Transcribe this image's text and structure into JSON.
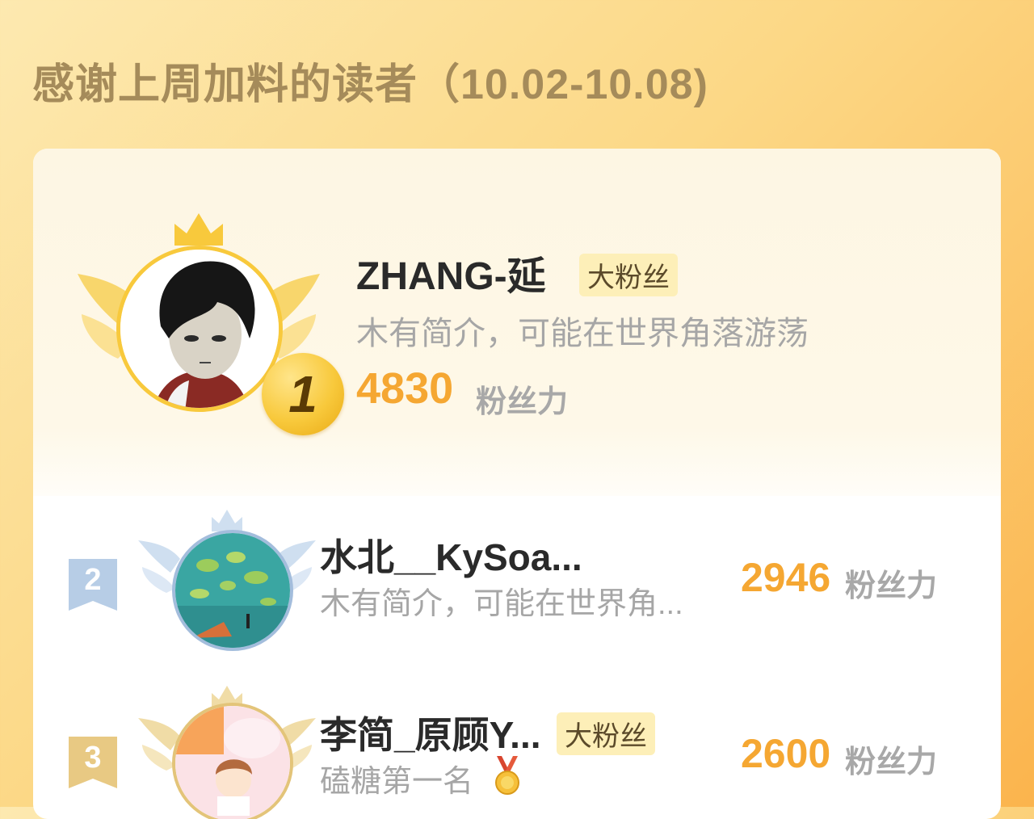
{
  "title": "感谢上周加料的读者（10.02-10.08)",
  "unit_label": "粉丝力",
  "fan_tag": "大粉丝",
  "top_reader": {
    "rank": "1",
    "name": "ZHANG-延",
    "bio": "木有简介，可能在世界角落游荡",
    "value": "4830"
  },
  "readers": [
    {
      "rank": "2",
      "name": "水北__KySoa...",
      "bio": "木有简介，可能在世界角...",
      "value": "2946"
    },
    {
      "rank": "3",
      "name": "李简_原顾Y...",
      "bio": "磕糖第一名",
      "value": "2600"
    }
  ],
  "colors": {
    "gold": "#f8c93c",
    "value": "#f5a732",
    "silver": "#b7cde6",
    "bronze": "#e8c983"
  },
  "icons": [
    "crown-icon",
    "wings-icon",
    "medal-icon"
  ]
}
